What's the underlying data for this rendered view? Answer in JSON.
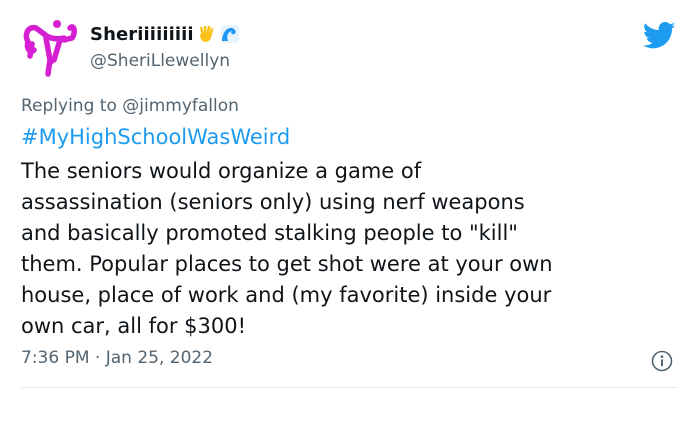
{
  "tweet": {
    "display_name": "Sheriiiiiiiii",
    "emoji_1": "vulcan-salute-emoji",
    "emoji_2": "water-wave-emoji",
    "handle": "@SheriLlewellyn",
    "replying_prefix": "Replying to",
    "replying_to": "@jimmyfallon",
    "hashtag": "#MyHighSchoolWasWeird",
    "body_lines": [
      "The seniors would organize a game of",
      "assassination (seniors only) using nerf weapons",
      "and basically promoted stalking people to \"kill\"",
      "them. Popular places to get shot were at your own",
      "house, place of work and (my favorite) inside your",
      "own car, all for $300!"
    ],
    "timestamp": "7:36 PM · Jan 25, 2022"
  },
  "icons": {
    "avatar": "uterus-logo-avatar",
    "platform": "twitter-bird-icon",
    "info": "info-icon"
  },
  "colors": {
    "accent": "#1d9bf0",
    "text": "#0f1419",
    "muted": "#536471",
    "avatar": "#d61ed3",
    "divider": "#e6ecf0"
  }
}
